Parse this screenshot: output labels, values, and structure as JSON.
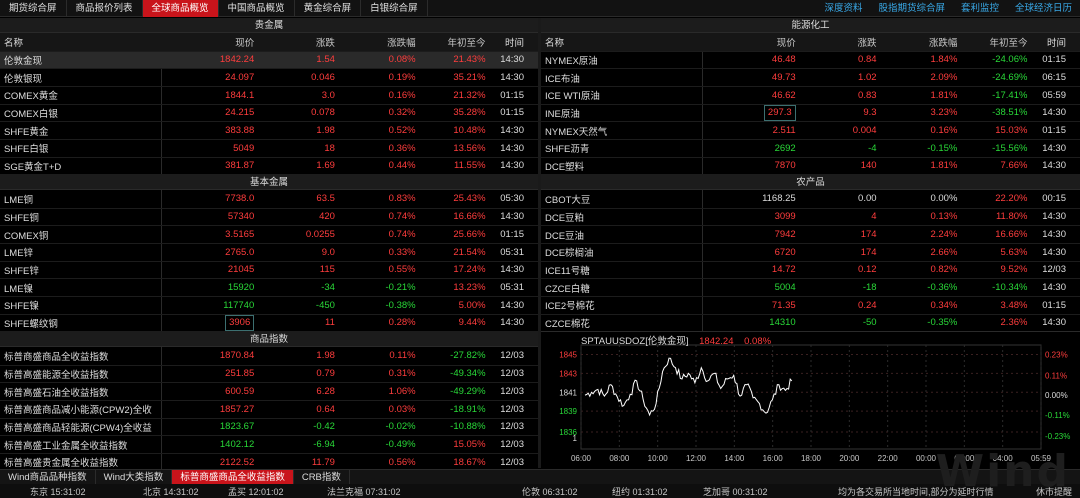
{
  "top_tabs": [
    "期货综合屏",
    "商品报价列表",
    "全球商品概览",
    "中国商品概览",
    "黄金综合屏",
    "白银综合屏"
  ],
  "active_top_tab": 2,
  "top_links": [
    "深度资料",
    "股指期货综合屏",
    "套利监控",
    "全球经济日历"
  ],
  "columns": {
    "name": "名称",
    "price": "现价",
    "change": "涨跌",
    "pct": "涨跌幅",
    "ytd": "年初至今",
    "time": "时间"
  },
  "left": {
    "sections": [
      {
        "title": "贵金属",
        "rows": [
          {
            "name": "伦敦金现",
            "price": "1842.24",
            "change": "1.54",
            "pct": "0.08%",
            "ytd": "21.43%",
            "time": "14:30",
            "dir": "up",
            "ytd_dir": "up"
          },
          {
            "name": "伦敦银现",
            "price": "24.097",
            "change": "0.046",
            "pct": "0.19%",
            "ytd": "35.21%",
            "time": "14:30",
            "dir": "up",
            "ytd_dir": "up"
          },
          {
            "name": "COMEX黄金",
            "price": "1844.1",
            "change": "3.0",
            "pct": "0.16%",
            "ytd": "21.32%",
            "time": "01:15",
            "dir": "up",
            "ytd_dir": "up"
          },
          {
            "name": "COMEX白银",
            "price": "24.215",
            "change": "0.078",
            "pct": "0.32%",
            "ytd": "35.28%",
            "time": "01:15",
            "dir": "up",
            "ytd_dir": "up"
          },
          {
            "name": "SHFE黄金",
            "price": "383.88",
            "change": "1.98",
            "pct": "0.52%",
            "ytd": "10.48%",
            "time": "14:30",
            "dir": "up",
            "ytd_dir": "up"
          },
          {
            "name": "SHFE白银",
            "price": "5049",
            "change": "18",
            "pct": "0.36%",
            "ytd": "13.56%",
            "time": "14:30",
            "dir": "up",
            "ytd_dir": "up"
          },
          {
            "name": "SGE黄金T+D",
            "price": "381.87",
            "change": "1.69",
            "pct": "0.44%",
            "ytd": "11.55%",
            "time": "14:30",
            "dir": "up",
            "ytd_dir": "up"
          }
        ]
      },
      {
        "title": "基本金属",
        "rows": [
          {
            "name": "LME铜",
            "price": "7738.0",
            "change": "63.5",
            "pct": "0.83%",
            "ytd": "25.43%",
            "time": "05:30",
            "dir": "up",
            "ytd_dir": "up"
          },
          {
            "name": "SHFE铜",
            "price": "57340",
            "change": "420",
            "pct": "0.74%",
            "ytd": "16.66%",
            "time": "14:30",
            "dir": "up",
            "ytd_dir": "up"
          },
          {
            "name": "COMEX铜",
            "price": "3.5165",
            "change": "0.0255",
            "pct": "0.74%",
            "ytd": "25.66%",
            "time": "01:15",
            "dir": "up",
            "ytd_dir": "up"
          },
          {
            "name": "LME锌",
            "price": "2765.0",
            "change": "9.0",
            "pct": "0.33%",
            "ytd": "21.54%",
            "time": "05:31",
            "dir": "up",
            "ytd_dir": "up"
          },
          {
            "name": "SHFE锌",
            "price": "21045",
            "change": "115",
            "pct": "0.55%",
            "ytd": "17.24%",
            "time": "14:30",
            "dir": "up",
            "ytd_dir": "up"
          },
          {
            "name": "LME镍",
            "price": "15920",
            "change": "-34",
            "pct": "-0.21%",
            "ytd": "13.23%",
            "time": "05:31",
            "dir": "down",
            "ytd_dir": "up"
          },
          {
            "name": "SHFE镍",
            "price": "117740",
            "change": "-450",
            "pct": "-0.38%",
            "ytd": "5.00%",
            "time": "14:30",
            "dir": "down",
            "ytd_dir": "up"
          },
          {
            "name": "SHFE螺纹钢",
            "price": "3906",
            "change": "11",
            "pct": "0.28%",
            "ytd": "9.44%",
            "time": "14:30",
            "dir": "up",
            "ytd_dir": "up",
            "boxed": true
          }
        ]
      },
      {
        "title": "商品指数",
        "rows": [
          {
            "name": "标普商盛商品全收益指数",
            "price": "1870.84",
            "change": "1.98",
            "pct": "0.11%",
            "ytd": "-27.82%",
            "time": "12/03",
            "dir": "up",
            "ytd_dir": "down"
          },
          {
            "name": "标普高盛能源全收益指数",
            "price": "251.85",
            "change": "0.79",
            "pct": "0.31%",
            "ytd": "-49.34%",
            "time": "12/03",
            "dir": "up",
            "ytd_dir": "down"
          },
          {
            "name": "标普高盛石油全收益指数",
            "price": "600.59",
            "change": "6.28",
            "pct": "1.06%",
            "ytd": "-49.29%",
            "time": "12/03",
            "dir": "up",
            "ytd_dir": "down"
          },
          {
            "name": "标普高盛商品减小能源(CPW2)全收",
            "price": "1857.27",
            "change": "0.64",
            "pct": "0.03%",
            "ytd": "-18.91%",
            "time": "12/03",
            "dir": "up",
            "ytd_dir": "down"
          },
          {
            "name": "标普高盛商品轻能源(CPW4)全收益",
            "price": "1823.67",
            "change": "-0.42",
            "pct": "-0.02%",
            "ytd": "-10.88%",
            "time": "12/03",
            "dir": "down",
            "ytd_dir": "down"
          },
          {
            "name": "标普高盛工业金属全收益指数",
            "price": "1402.12",
            "change": "-6.94",
            "pct": "-0.49%",
            "ytd": "15.05%",
            "time": "12/03",
            "dir": "down",
            "ytd_dir": "up"
          },
          {
            "name": "标普高盛贵金属全收益指数",
            "price": "2122.52",
            "change": "11.79",
            "pct": "0.56%",
            "ytd": "18.67%",
            "time": "12/03",
            "dir": "up",
            "ytd_dir": "up"
          }
        ]
      }
    ]
  },
  "right": {
    "sections": [
      {
        "title": "能源化工",
        "rows": [
          {
            "name": "NYMEX原油",
            "price": "46.48",
            "change": "0.84",
            "pct": "1.84%",
            "ytd": "-24.06%",
            "time": "01:15",
            "dir": "up",
            "ytd_dir": "down"
          },
          {
            "name": "ICE布油",
            "price": "49.73",
            "change": "1.02",
            "pct": "2.09%",
            "ytd": "-24.69%",
            "time": "06:15",
            "dir": "up",
            "ytd_dir": "down"
          },
          {
            "name": "ICE WTI原油",
            "price": "46.62",
            "change": "0.83",
            "pct": "1.81%",
            "ytd": "-17.41%",
            "time": "05:59",
            "dir": "up",
            "ytd_dir": "down"
          },
          {
            "name": "INE原油",
            "price": "297.3",
            "change": "9.3",
            "pct": "3.23%",
            "ytd": "-38.51%",
            "time": "14:30",
            "dir": "up",
            "ytd_dir": "down",
            "boxed": true
          },
          {
            "name": "NYMEX天然气",
            "price": "2.511",
            "change": "0.004",
            "pct": "0.16%",
            "ytd": "15.03%",
            "time": "01:15",
            "dir": "up",
            "ytd_dir": "up"
          },
          {
            "name": "SHFE沥青",
            "price": "2692",
            "change": "-4",
            "pct": "-0.15%",
            "ytd": "-15.56%",
            "time": "14:30",
            "dir": "down",
            "ytd_dir": "down"
          },
          {
            "name": "DCE塑料",
            "price": "7870",
            "change": "140",
            "pct": "1.81%",
            "ytd": "7.66%",
            "time": "14:30",
            "dir": "up",
            "ytd_dir": "up"
          }
        ]
      },
      {
        "title": "农产品",
        "rows": [
          {
            "name": "CBOT大豆",
            "price": "1168.25",
            "change": "0.00",
            "pct": "0.00%",
            "ytd": "22.20%",
            "time": "00:15",
            "dir": "flat",
            "ytd_dir": "up"
          },
          {
            "name": "DCE豆粕",
            "price": "3099",
            "change": "4",
            "pct": "0.13%",
            "ytd": "11.80%",
            "time": "14:30",
            "dir": "up",
            "ytd_dir": "up"
          },
          {
            "name": "DCE豆油",
            "price": "7942",
            "change": "174",
            "pct": "2.24%",
            "ytd": "16.66%",
            "time": "14:30",
            "dir": "up",
            "ytd_dir": "up"
          },
          {
            "name": "DCE棕榈油",
            "price": "6720",
            "change": "174",
            "pct": "2.66%",
            "ytd": "5.63%",
            "time": "14:30",
            "dir": "up",
            "ytd_dir": "up"
          },
          {
            "name": "ICE11号糖",
            "price": "14.72",
            "change": "0.12",
            "pct": "0.82%",
            "ytd": "9.52%",
            "time": "12/03",
            "dir": "up",
            "ytd_dir": "up"
          },
          {
            "name": "CZCE白糖",
            "price": "5004",
            "change": "-18",
            "pct": "-0.36%",
            "ytd": "-10.34%",
            "time": "14:30",
            "dir": "down",
            "ytd_dir": "down"
          },
          {
            "name": "ICE2号棉花",
            "price": "71.35",
            "change": "0.24",
            "pct": "0.34%",
            "ytd": "3.48%",
            "time": "01:15",
            "dir": "up",
            "ytd_dir": "up"
          },
          {
            "name": "CZCE棉花",
            "price": "14310",
            "change": "-50",
            "pct": "-0.35%",
            "ytd": "2.36%",
            "time": "14:30",
            "dir": "down",
            "ytd_dir": "up"
          }
        ]
      }
    ]
  },
  "chart": {
    "title": "SPTAUUSDOZ[伦敦金现]",
    "price": "1842.24",
    "pct": "0.08%",
    "y_left_ticks": [
      "1845",
      "1843",
      "1841",
      "1839",
      "1836",
      "1"
    ],
    "y_right_ticks": [
      "0.23%",
      "0.11%",
      "0.00%",
      "-0.11%",
      "-0.23%"
    ],
    "x_ticks": [
      "06:00",
      "08:00",
      "10:00",
      "12:00",
      "14:00",
      "16:00",
      "18:00",
      "20:00",
      "22:00",
      "00:00",
      "02:00",
      "04:00",
      "05:59"
    ]
  },
  "chart_data": {
    "type": "line",
    "title": "SPTAUUSDOZ[伦敦金现]",
    "x": [
      "06:00",
      "06:30",
      "07:00",
      "07:20",
      "07:40",
      "08:00",
      "08:20",
      "08:40",
      "09:00",
      "09:20",
      "09:40",
      "10:00",
      "10:20",
      "10:40",
      "11:00",
      "11:20",
      "11:40",
      "12:00",
      "12:20",
      "12:40",
      "13:00",
      "13:20",
      "13:40",
      "14:00",
      "14:20",
      "14:40",
      "15:00",
      "15:20",
      "15:40",
      "16:00",
      "16:20",
      "16:40",
      "17:00"
    ],
    "series": [
      {
        "values": [
          1840.7,
          1841.0,
          1841.3,
          1840.6,
          1841.8,
          1840.5,
          1839.6,
          1840.8,
          1842.2,
          1840.2,
          1838.6,
          1839.8,
          1843.2,
          1844.6,
          1843.6,
          1842.4,
          1843.0,
          1842.0,
          1843.6,
          1842.2,
          1843.0,
          1841.4,
          1842.4,
          1842.8,
          1840.6,
          1841.8,
          1840.4,
          1839.8,
          1838.8,
          1840.2,
          1841.8,
          1841.2,
          1842.2
        ]
      }
    ],
    "ylim": [
      1835,
      1846
    ],
    "baseline": 1840.7
  },
  "bottom_tabs": [
    "Wind商品品种指数",
    "Wind大类指数",
    "标普商盛商品全收益指数",
    "CRB指数"
  ],
  "active_bottom_tab": 2,
  "status": {
    "clocks": [
      "东京 15:31:02",
      "北京 14:31:02",
      "孟买 12:01:02",
      "法兰克福 07:31:02",
      "伦敦 06:31:02",
      "纽约 01:31:02",
      "芝加哥 00:31:02"
    ],
    "note": "均为各交易所当地时间,部分为延时行情",
    "closed": "休市提醒"
  },
  "logo_text": "Wind"
}
